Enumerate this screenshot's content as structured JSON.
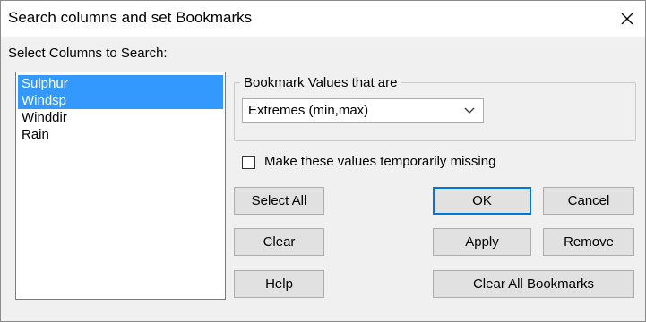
{
  "dialog": {
    "title": "Search columns and set Bookmarks",
    "close_icon": "close-icon"
  },
  "columns": {
    "label": "Select Columns to Search:",
    "items": [
      {
        "label": "Sulphur",
        "selected": true
      },
      {
        "label": "Windsp",
        "selected": true
      },
      {
        "label": "Winddir",
        "selected": false
      },
      {
        "label": "Rain",
        "selected": false
      }
    ]
  },
  "bookmark": {
    "group_label": "Bookmark Values that are",
    "combo_value": "Extremes (min,max)",
    "combo_icon": "chevron-down-icon"
  },
  "missing": {
    "label": "Make these values temporarily missing",
    "checked": false
  },
  "buttons": {
    "select_all": "Select All",
    "clear": "Clear",
    "help": "Help",
    "ok": "OK",
    "cancel": "Cancel",
    "apply": "Apply",
    "remove": "Remove",
    "clear_all_bookmarks": "Clear All Bookmarks"
  },
  "colors": {
    "selection": "#3399ff",
    "default_button_border": "#0078d7"
  }
}
